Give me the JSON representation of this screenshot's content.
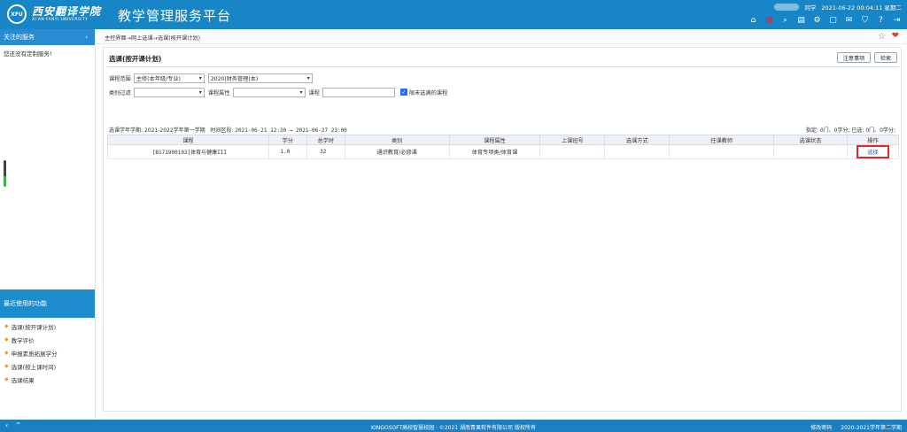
{
  "header": {
    "school_cn": "西安翻译学院",
    "school_en": "XI'AN FANYI UNIVERSITY",
    "school_seal": "XFU",
    "platform_title": "教学管理服务平台",
    "user": "同学",
    "datetime": "2021-06-22 00:04:11 星期二",
    "icons": [
      "home-icon",
      "apps-icon",
      "search-icon",
      "calendar-icon",
      "settings-icon",
      "window-icon",
      "message-icon",
      "shirt-icon",
      "help-icon",
      "logout-icon"
    ]
  },
  "sidebar": {
    "fav_title": "关注的服务",
    "fav_empty": "您还没有定制服务!",
    "recent_title": "最近使用的功能",
    "recent_items": [
      "选课(按开课计划)",
      "教学评价",
      "申报素质拓展学分",
      "选课(按上课时间)",
      "选课结果"
    ]
  },
  "main": {
    "breadcrumb": "主控界面→网上选课→选课(按开课计划)",
    "heading": "选课(按开课计划)",
    "btn_notice": "注意事项",
    "btn_search": "检索",
    "filters": {
      "scope_label": "课程范围",
      "scope_value": "主修(本年级/专业)",
      "major_value": "2020|财务管理(本)",
      "category_label": "类别过滤",
      "category_value": "",
      "attr_label": "课程属性",
      "attr_value": "",
      "course_label": "课程",
      "course_placeholder": "",
      "unselected_label": "限未选满的课程",
      "unselected_checked": true
    },
    "semester_info": {
      "label": "选课学年学期:",
      "term": "2021-2022学年第一学期",
      "period_label": "时间区段:",
      "period": "2021-06-21 12:30 → 2021-06-27 23:00"
    },
    "quota": "指定: 0门、0学分; 已选: 0门、0学分;",
    "table": {
      "headers": [
        "课程",
        "学分",
        "总学时",
        "类别",
        "课程属性",
        "上课班号",
        "选课方式",
        "任课教师",
        "选课状态",
        "操作"
      ],
      "rows": [
        {
          "course": "[B171900103]体育与健康III",
          "credit": "1.0",
          "hours": "32",
          "category": "通识教育/必修课",
          "attr": "体育专项类/体育课",
          "class_no": "",
          "method": "",
          "teacher": "",
          "status": "",
          "action": "选择"
        }
      ]
    }
  },
  "footer": {
    "copyright": "KINGOSOFT高校智慧校园 · ©2021 湖南青果软件有限公司 版权所有",
    "change_password": "修改密码",
    "current_term": "2020-2021学年第二学期"
  }
}
